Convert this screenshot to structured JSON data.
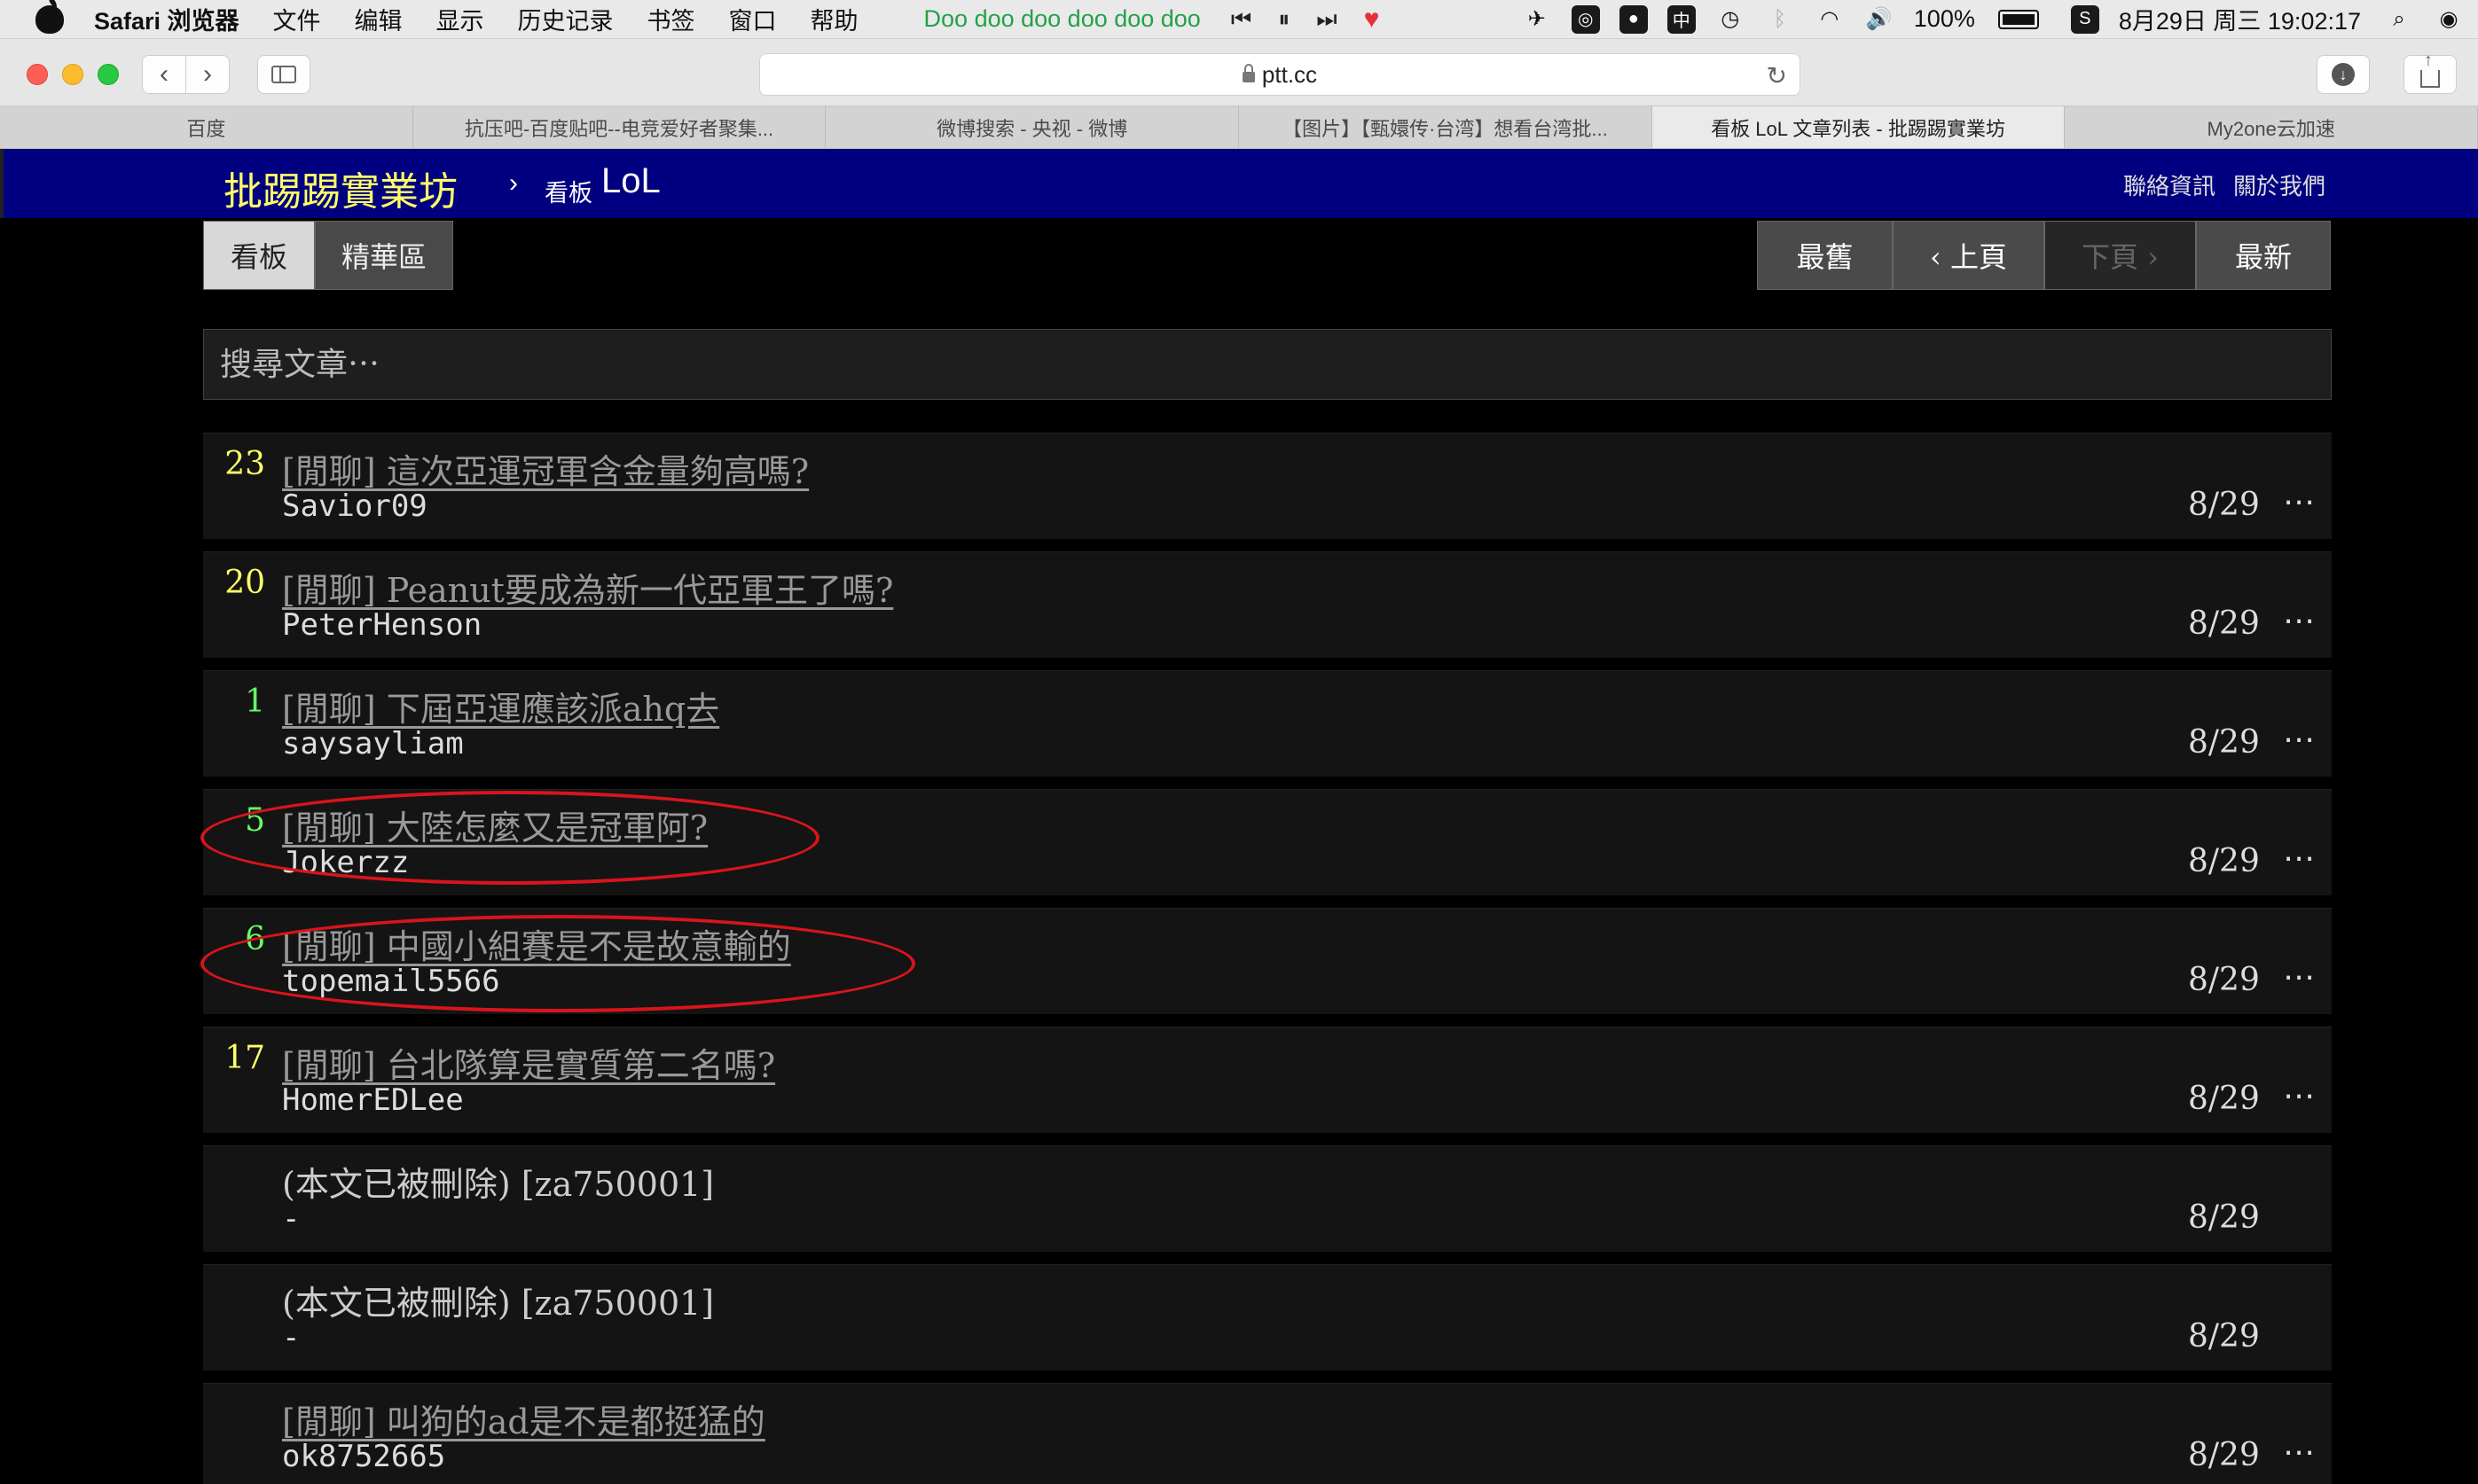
{
  "menubar": {
    "app": "Safari 浏览器",
    "items": [
      "文件",
      "编辑",
      "显示",
      "历史记录",
      "书签",
      "窗口",
      "帮助"
    ],
    "now_playing": "Doo doo doo doo doo doo",
    "battery": "100%",
    "datetime": "8月29日 周三 19:02:17"
  },
  "browser": {
    "url": "ptt.cc",
    "tabs": [
      {
        "label": "百度"
      },
      {
        "label": "抗压吧-百度贴吧--电竞爱好者聚集..."
      },
      {
        "label": "微博搜索 - 央视 - 微博"
      },
      {
        "label": "【图片】【甄嬛传·台湾】想看台湾批..."
      },
      {
        "label": "看板 LoL 文章列表 - 批踢踢實業坊"
      },
      {
        "label": "My2one云加速"
      }
    ]
  },
  "site": {
    "title": "批踢踢實業坊",
    "chevron": "›",
    "board_label": "看板",
    "board_name": "LoL",
    "contact": "聯絡資訊",
    "about": "關於我們"
  },
  "nav": {
    "board_tab": "看板",
    "digest_tab": "精華區",
    "oldest": "最舊",
    "prev": "‹ 上頁",
    "next": "下頁 ›",
    "newest": "最新"
  },
  "search": {
    "placeholder": "搜尋文章⋯"
  },
  "posts": [
    {
      "count": "23",
      "count_color": "#ffff66",
      "title": "[閒聊] 這次亞運冠軍含金量夠高嗎? ",
      "author": "Savior09",
      "date": "8/29",
      "more": "⋯"
    },
    {
      "count": "20",
      "count_color": "#ffff66",
      "title": "[閒聊] Peanut要成為新一代亞軍王了嗎? ",
      "author": "PeterHenson",
      "date": "8/29",
      "more": "⋯"
    },
    {
      "count": "1",
      "count_color": "#66ff66",
      "title": "[閒聊] 下屆亞運應該派ahq去",
      "author": "saysayliam",
      "date": "8/29",
      "more": "⋯"
    },
    {
      "count": "5",
      "count_color": "#66ff66",
      "title": "[閒聊] 大陸怎麼又是冠軍阿?",
      "author": "Jokerzz",
      "date": "8/29",
      "more": "⋯"
    },
    {
      "count": "6",
      "count_color": "#66ff66",
      "title": "[閒聊] 中國小組賽是不是故意輸的",
      "author": "topemail5566",
      "date": "8/29",
      "more": "⋯"
    },
    {
      "count": "17",
      "count_color": "#ffff66",
      "title": "[閒聊] 台北隊算是實質第二名嗎? ",
      "author": "HomerEDLee",
      "date": "8/29",
      "more": "⋯"
    },
    {
      "count": "",
      "count_color": "#ffff66",
      "title": "(本文已被刪除) [za750001]",
      "author": "-",
      "date": "8/29",
      "more": ""
    },
    {
      "count": "",
      "count_color": "#ffff66",
      "title": "(本文已被刪除) [za750001]",
      "author": "-",
      "date": "8/29",
      "more": ""
    },
    {
      "count": "",
      "count_color": "#ffff66",
      "title": "[閒聊] 叫狗的ad是不是都挺猛的",
      "author": "ok8752665",
      "date": "8/29",
      "more": "⋯"
    }
  ]
}
